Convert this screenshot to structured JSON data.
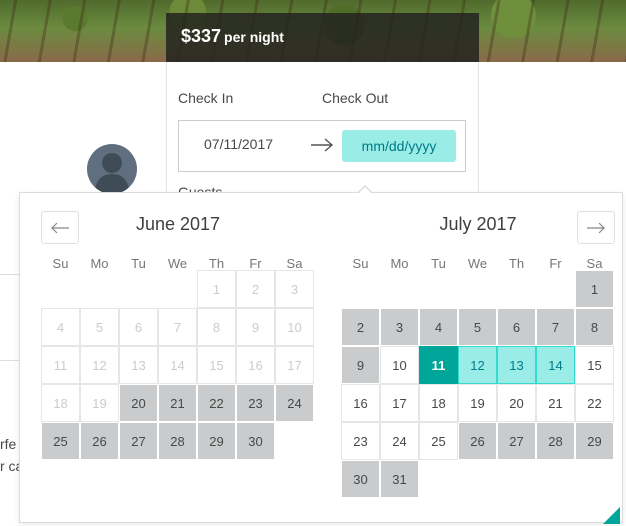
{
  "listing": {
    "price": "$337",
    "price_unit": "per night"
  },
  "booking": {
    "check_in_label": "Check In",
    "check_out_label": "Check Out",
    "check_in_value": "07/11/2017",
    "check_out_placeholder": "mm/dd/yyyy",
    "guests_label": "Guests"
  },
  "page_fragments": {
    "text_line_1": "rfe",
    "text_line_2": "r ca"
  },
  "calendar": {
    "months": [
      {
        "title": "June 2017"
      },
      {
        "title": "July 2017"
      }
    ],
    "weekdays": [
      "Su",
      "Mo",
      "Tu",
      "We",
      "Th",
      "Fr",
      "Sa"
    ],
    "prev_icon": "arrow-left-icon",
    "next_icon": "arrow-right-icon",
    "colors": {
      "selected_start": "#00a699",
      "selected_span": "#99ede6",
      "blocked": "#c9cbcd",
      "past": "#cacccd"
    }
  }
}
